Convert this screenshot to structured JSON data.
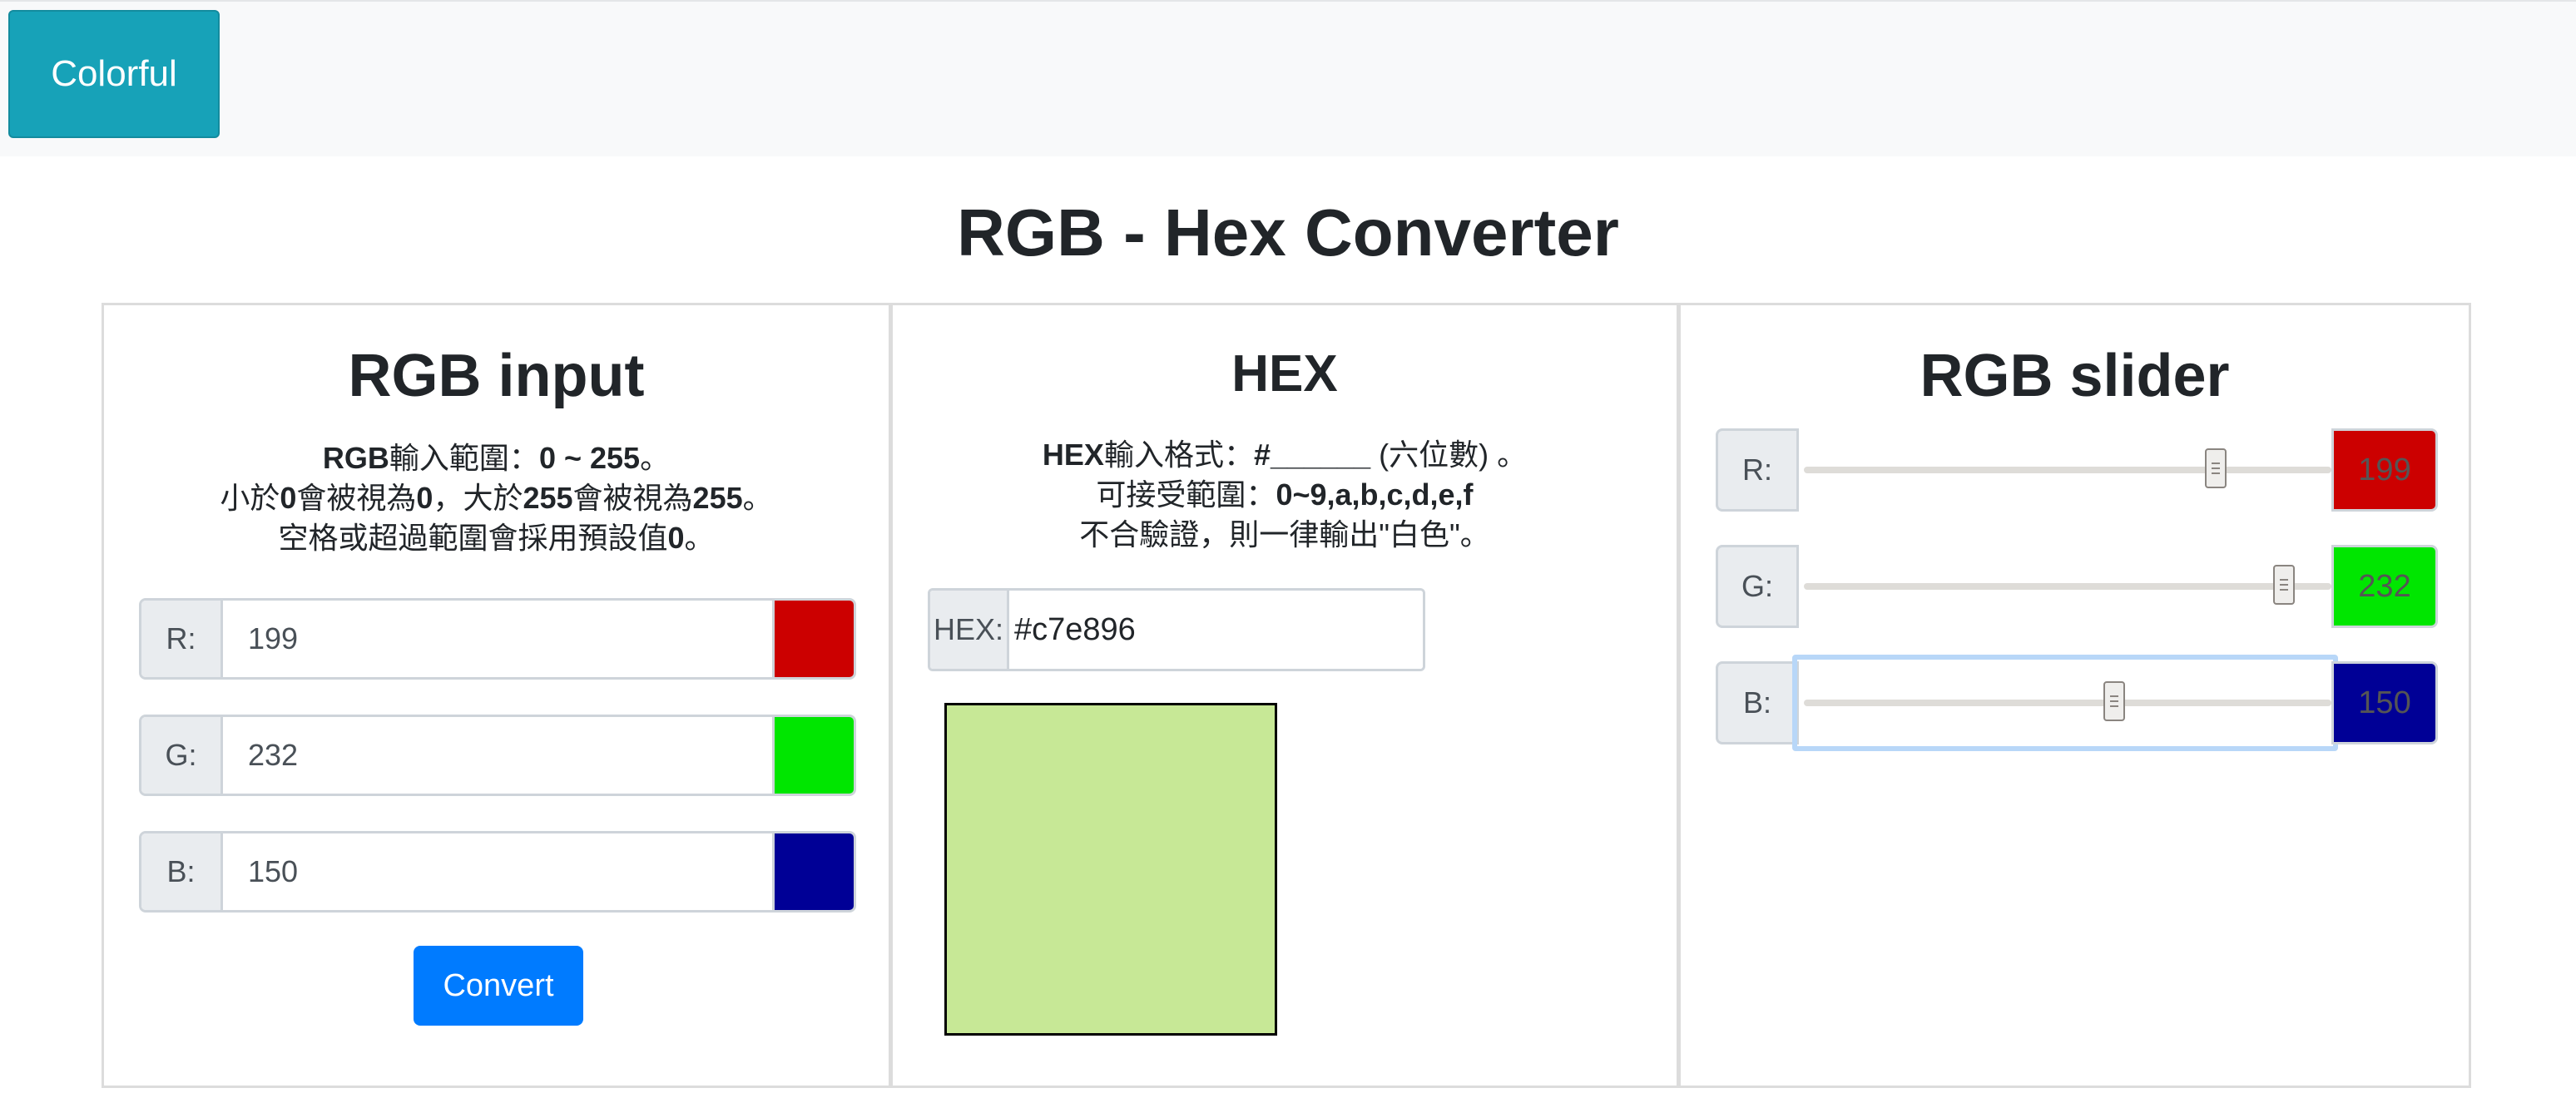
{
  "navbar": {
    "brand": "Colorful"
  },
  "page_title": "RGB - Hex Converter",
  "rgb_input": {
    "title": "RGB input",
    "notes": {
      "line1_a": "RGB",
      "line1_b": "輸入範圍：",
      "line1_c": "0 ~ 255",
      "line1_d": "。",
      "line2_a": "小於",
      "line2_b": "0",
      "line2_c": "會被視為",
      "line2_d": "0",
      "line2_e": "，大於",
      "line2_f": "255",
      "line2_g": "會被視為",
      "line2_h": "255",
      "line2_i": "。",
      "line3_a": "空格或超過範圍會採用預設值",
      "line3_b": "0",
      "line3_c": "。"
    },
    "fields": [
      {
        "label": "R:",
        "value": "199",
        "swatch": "#cc0000"
      },
      {
        "label": "G:",
        "value": "232",
        "swatch": "#00e600"
      },
      {
        "label": "B:",
        "value": "150",
        "swatch": "#000096"
      }
    ],
    "convert_label": "Convert"
  },
  "hex": {
    "title": "HEX",
    "notes": {
      "line1_a": "HEX",
      "line1_b": "輸入格式：",
      "line1_c": "#______",
      "line1_d": " (六位數) 。",
      "line2_a": "可接受範圍：",
      "line2_b": "0~9,a,b,c,d,e,f",
      "line3": "不合驗證，則一律輸出\"白色\"。"
    },
    "label": "HEX:",
    "value": "#c7e896",
    "preview_color": "#c7e896"
  },
  "rgb_slider": {
    "title": "RGB slider",
    "sliders": [
      {
        "label": "R:",
        "value": "199",
        "fraction": 0.7804,
        "color": "#cc0000"
      },
      {
        "label": "G:",
        "value": "232",
        "fraction": 0.9098,
        "color": "#00e600"
      },
      {
        "label": "B:",
        "value": "150",
        "fraction": 0.5882,
        "color": "#000096"
      }
    ],
    "focused": "B"
  }
}
